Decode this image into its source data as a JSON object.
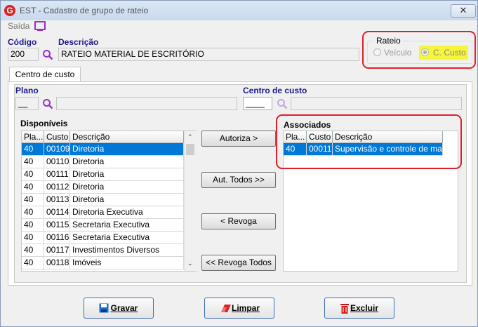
{
  "window": {
    "title": "EST - Cadastro de grupo de rateio",
    "close_glyph": "✕",
    "app_icon_letter": "G"
  },
  "menu": {
    "saida": "Saída"
  },
  "form": {
    "codigo_label": "Código",
    "codigo_value": "200",
    "descricao_label": "Descrição",
    "descricao_value": "RATEIO MATERIAL DE ESCRITÓRIO"
  },
  "rateio": {
    "label": "Rateio",
    "options": [
      "Veículo",
      "C. Custo"
    ],
    "selected": "C. Custo"
  },
  "tab": {
    "label": "Centro de custo"
  },
  "filters": {
    "plano_label": "Plano",
    "plano_value": "__",
    "centro_label": "Centro de custo",
    "centro_value": "____"
  },
  "disponiveis": {
    "label": "Disponíveis",
    "columns": [
      "Pla...",
      "Custo",
      "Descrição"
    ],
    "rows": [
      [
        "40",
        "00109",
        "Diretoria"
      ],
      [
        "40",
        "00110",
        "Diretoria"
      ],
      [
        "40",
        "00111",
        "Diretoria"
      ],
      [
        "40",
        "00112",
        "Diretoria"
      ],
      [
        "40",
        "00113",
        "Diretoria"
      ],
      [
        "40",
        "00114",
        "Diretoria Executiva"
      ],
      [
        "40",
        "00115",
        "Secretaria Executiva"
      ],
      [
        "40",
        "00116",
        "Secretaria Executiva"
      ],
      [
        "40",
        "00117",
        "Investimentos Diversos"
      ],
      [
        "40",
        "00118",
        "Imóveis"
      ]
    ]
  },
  "associados": {
    "label": "Associados",
    "columns": [
      "Pla...",
      "Custo",
      "Descrição"
    ],
    "rows": [
      [
        "40",
        "00011",
        "Supervisão e controle de manut"
      ]
    ]
  },
  "transfer_buttons": {
    "autoriza": "Autoriza >",
    "aut_todos": "Aut. Todos >>",
    "revoga": "< Revoga",
    "revoga_todos": "<< Revoga Todos"
  },
  "actions": {
    "gravar": "Gravar",
    "limpar": "Limpar",
    "excluir": "Excluir"
  },
  "colors": {
    "accent": "#0078d7",
    "highlight": "#e0202a",
    "label_blue": "#1a1a8a",
    "selected_radio_bg": "#f5f53a"
  }
}
